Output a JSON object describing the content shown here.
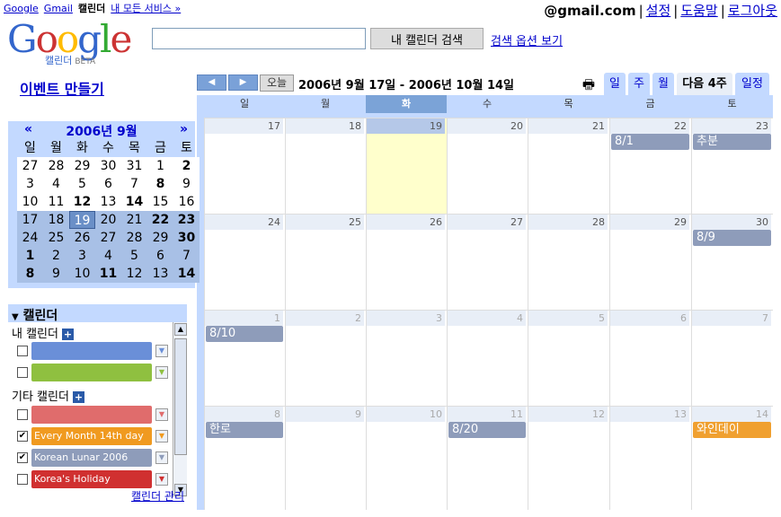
{
  "topnav": {
    "google": "Google",
    "gmail": "Gmail",
    "calendar": "캘린더",
    "all": "내 모든 서비스 »"
  },
  "account": {
    "email": "@gmail.com",
    "settings": "설정",
    "help": "도움말",
    "logout": "로그아웃",
    "sep": "|"
  },
  "logo": {
    "text": "Google",
    "sub": "캘린더",
    "beta": "BETA"
  },
  "search": {
    "button": "내 캘린더 검색",
    "options": "검색 옵션 보기",
    "value": ""
  },
  "create_event": "이벤트 만들기",
  "toolbar": {
    "prev": "◀",
    "next": "▶",
    "today": "오늘",
    "range": "2006년 9월 17일 - 2006년 10월 14일",
    "print_icon": "🖶"
  },
  "view_tabs": [
    "일",
    "주",
    "월",
    "다음 4주",
    "일정"
  ],
  "day_headers": [
    "일",
    "월",
    "화",
    "수",
    "목",
    "금",
    "토"
  ],
  "weeks": [
    {
      "days": [
        "17",
        "18",
        "19",
        "20",
        "21",
        "22",
        "23"
      ]
    },
    {
      "days": [
        "24",
        "25",
        "26",
        "27",
        "28",
        "29",
        "30"
      ]
    },
    {
      "days": [
        "1",
        "2",
        "3",
        "4",
        "5",
        "6",
        "7"
      ]
    },
    {
      "days": [
        "8",
        "9",
        "10",
        "11",
        "12",
        "13",
        "14"
      ]
    }
  ],
  "events": [
    {
      "label": "8/1",
      "color": "#8e9cba"
    },
    {
      "label": "추분",
      "color": "#8e9cba"
    },
    {
      "label": "8/9",
      "color": "#8e9cba"
    },
    {
      "label": "8/10",
      "color": "#8e9cba"
    },
    {
      "label": "한로",
      "color": "#8e9cba"
    },
    {
      "label": "8/20",
      "color": "#8e9cba"
    },
    {
      "label": "와인데이",
      "color": "#f0a030"
    }
  ],
  "mini": {
    "title": "2006년 9월",
    "prev": "«",
    "next": "»",
    "weekdays": [
      "일",
      "월",
      "화",
      "수",
      "목",
      "금",
      "토"
    ],
    "rows": [
      [
        "27",
        "28",
        "29",
        "30",
        "31",
        "1",
        "2"
      ],
      [
        "3",
        "4",
        "5",
        "6",
        "7",
        "8",
        "9"
      ],
      [
        "10",
        "11",
        "12",
        "13",
        "14",
        "15",
        "16"
      ],
      [
        "17",
        "18",
        "19",
        "20",
        "21",
        "22",
        "23"
      ],
      [
        "24",
        "25",
        "26",
        "27",
        "28",
        "29",
        "30"
      ],
      [
        "1",
        "2",
        "3",
        "4",
        "5",
        "6",
        "7"
      ],
      [
        "8",
        "9",
        "10",
        "11",
        "12",
        "13",
        "14"
      ]
    ]
  },
  "calendars": {
    "title": "캘린더",
    "mine_label": "내 캘린더",
    "other_label": "기타 캘린더",
    "plus": "+",
    "mine": [
      {
        "name": "",
        "color": "#6a8fd8",
        "checked": false
      },
      {
        "name": "",
        "color": "#8fc040",
        "checked": false
      }
    ],
    "other": [
      {
        "name": "",
        "color": "#e06c6c",
        "checked": false
      },
      {
        "name": "Every Month 14th day",
        "color": "#f09a20",
        "checked": true
      },
      {
        "name": "Korean Lunar 2006",
        "color": "#8e9cba",
        "checked": true
      },
      {
        "name": "Korea's Holiday",
        "color": "#d03030",
        "checked": false
      }
    ],
    "manage": "캘린더 관리"
  }
}
